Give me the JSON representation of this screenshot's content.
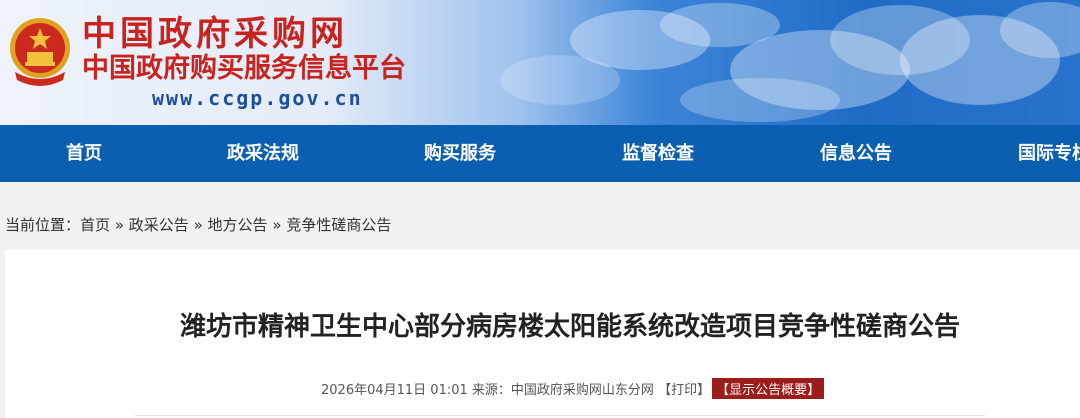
{
  "header": {
    "title_line1": "中国政府采购网",
    "title_line2": "中国政府购买服务信息平台",
    "url": "www.ccgp.gov.cn",
    "emblem_icon": "national-emblem-icon",
    "brand_color": "#c8231f",
    "url_color": "#1c4f9c"
  },
  "nav": {
    "bg_color": "#0b5fb0",
    "items": [
      "首页",
      "政采法规",
      "购买服务",
      "监督检查",
      "信息公告",
      "国际专栏"
    ]
  },
  "breadcrumb": {
    "prefix": "当前位置：",
    "items": [
      "首页",
      "政采公告",
      "地方公告",
      "竞争性磋商公告"
    ],
    "separator": "»"
  },
  "article": {
    "title": "潍坊市精神卫生中心部分病房楼太阳能系统改造项目竞争性磋商公告",
    "date": "2026年04月11日 01:01",
    "source_label": "来源：",
    "source": "中国政府采购网山东分网",
    "print_label": "【打印】",
    "summary_label": "【显示公告概要】",
    "summary_color": "#9e1b1b"
  }
}
